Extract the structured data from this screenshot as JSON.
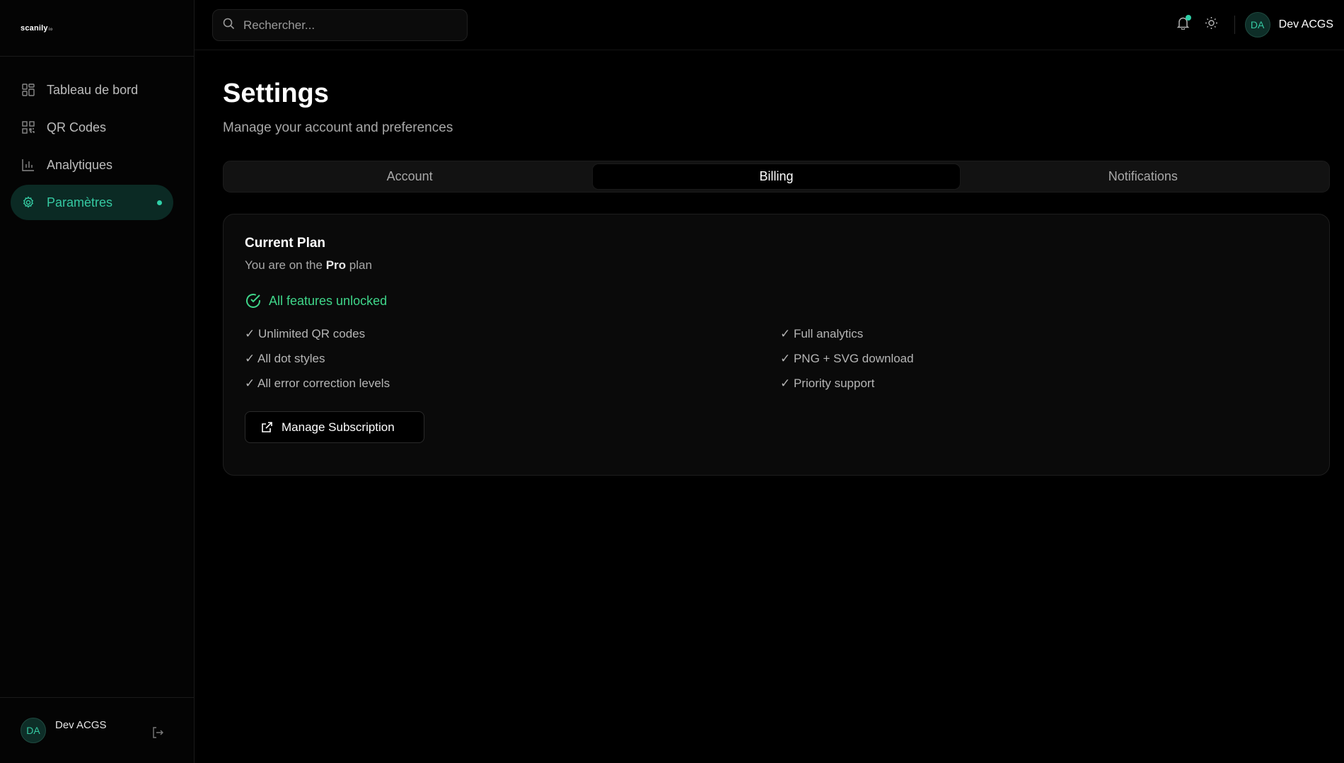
{
  "brand": {
    "name": "scanily",
    "suffix": "io"
  },
  "sidebar": {
    "items": [
      {
        "label": "Tableau de bord",
        "icon": "dashboard-icon",
        "active": false
      },
      {
        "label": "QR Codes",
        "icon": "qr-code-icon",
        "active": false
      },
      {
        "label": "Analytiques",
        "icon": "bar-chart-icon",
        "active": false
      },
      {
        "label": "Paramètres",
        "icon": "gear-icon",
        "active": true
      }
    ],
    "footer": {
      "initials": "DA",
      "name": "Dev ACGS"
    }
  },
  "topbar": {
    "search_placeholder": "Rechercher...",
    "user": {
      "initials": "DA",
      "name": "Dev ACGS"
    }
  },
  "page": {
    "title": "Settings",
    "subtitle": "Manage your account and preferences"
  },
  "tabs": [
    {
      "label": "Account",
      "active": false
    },
    {
      "label": "Billing",
      "active": true
    },
    {
      "label": "Notifications",
      "active": false
    }
  ],
  "plan_card": {
    "title": "Current Plan",
    "sub_prefix": "You are on the ",
    "plan_name": "Pro",
    "sub_suffix": " plan",
    "status": "All features unlocked",
    "features": [
      "✓ Unlimited QR codes",
      "✓ Full analytics",
      "✓ All dot styles",
      "✓ PNG + SVG download",
      "✓ All error correction levels",
      "✓ Priority support"
    ],
    "manage_label": "Manage Subscription"
  },
  "colors": {
    "accent": "#2fd0a8",
    "success": "#3fd68a",
    "background": "#000000"
  }
}
